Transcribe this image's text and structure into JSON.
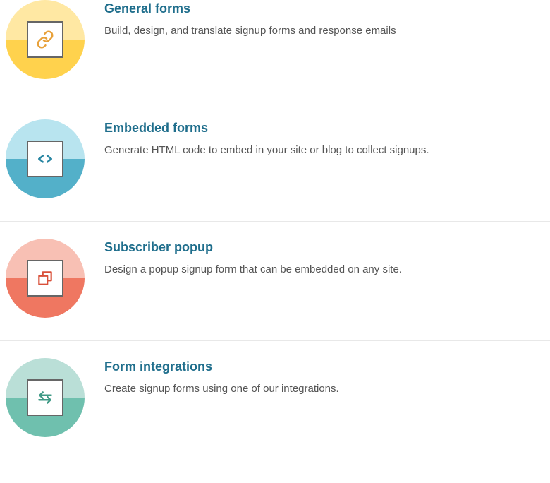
{
  "options": [
    {
      "title": "General forms",
      "desc": "Build, design, and translate signup forms and response emails"
    },
    {
      "title": "Embedded forms",
      "desc": "Generate HTML code to embed in your site or blog to collect signups."
    },
    {
      "title": "Subscriber popup",
      "desc": "Design a popup signup form that can be embedded on any site."
    },
    {
      "title": "Form integrations",
      "desc": "Create signup forms using one of our integrations."
    }
  ]
}
